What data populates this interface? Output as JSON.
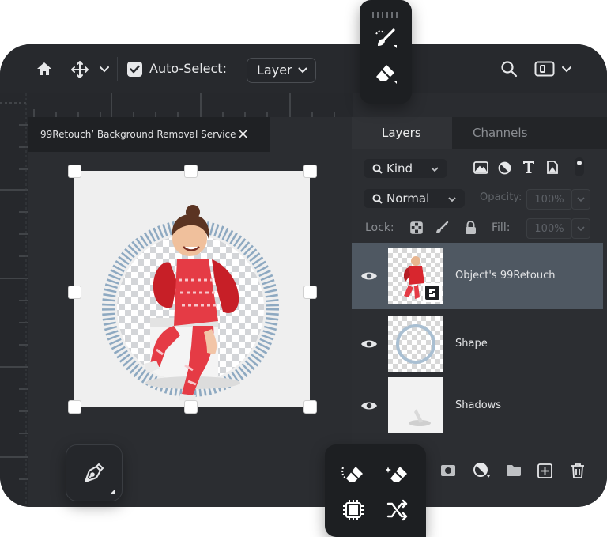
{
  "toolbar": {
    "home_icon": "home-icon",
    "move_icon": "move-icon",
    "auto_select_checked": true,
    "auto_select_label": "Auto-Select:",
    "auto_select_value": "Layer"
  },
  "document": {
    "tab_title": "99Retouch’ Background Removal Service",
    "close_glyph": "×"
  },
  "panel": {
    "tabs": [
      {
        "label": "Layers",
        "active": true
      },
      {
        "label": "Channels",
        "active": false
      }
    ],
    "filter_kind": "Kind",
    "blend_mode": "Normal",
    "opacity_label": "Opacity:",
    "opacity_value": "100%",
    "lock_label": "Lock:",
    "fill_label": "Fill:",
    "fill_value": "100%",
    "layers": [
      {
        "name": "Object's 99Retouch",
        "selected": true,
        "visible": true
      },
      {
        "name": "Shape",
        "selected": false,
        "visible": true
      },
      {
        "name": "Shadows",
        "selected": false,
        "visible": true
      }
    ]
  },
  "floating_tools": {
    "top": [
      "healing-brush-icon",
      "eraser-icon"
    ],
    "bottom": [
      "background-eraser-icon",
      "magic-eraser-icon",
      "chip-icon",
      "shuffle-icon"
    ],
    "pen": "pen-tool-icon"
  },
  "colors": {
    "window_bg": "#2a2c30",
    "panel_bg": "#2c2e32",
    "selected_layer": "#4f5862",
    "ring": "#7e9bb5",
    "outfit_red": "#d8262e"
  }
}
